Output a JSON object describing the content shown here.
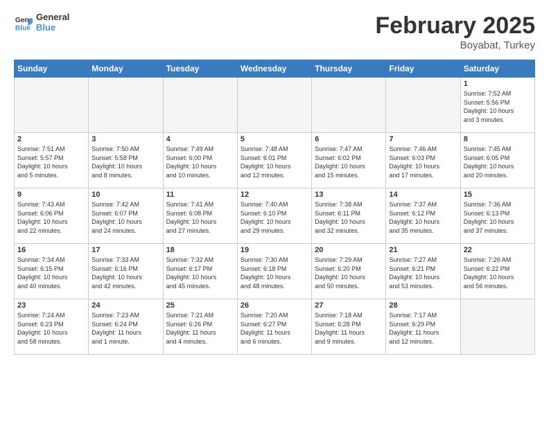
{
  "header": {
    "logo_general": "General",
    "logo_blue": "Blue",
    "month_title": "February 2025",
    "location": "Boyabat, Turkey"
  },
  "weekdays": [
    "Sunday",
    "Monday",
    "Tuesday",
    "Wednesday",
    "Thursday",
    "Friday",
    "Saturday"
  ],
  "weeks": [
    [
      {
        "day": "",
        "info": ""
      },
      {
        "day": "",
        "info": ""
      },
      {
        "day": "",
        "info": ""
      },
      {
        "day": "",
        "info": ""
      },
      {
        "day": "",
        "info": ""
      },
      {
        "day": "",
        "info": ""
      },
      {
        "day": "1",
        "info": "Sunrise: 7:52 AM\nSunset: 5:56 PM\nDaylight: 10 hours\nand 3 minutes."
      }
    ],
    [
      {
        "day": "2",
        "info": "Sunrise: 7:51 AM\nSunset: 5:57 PM\nDaylight: 10 hours\nand 5 minutes."
      },
      {
        "day": "3",
        "info": "Sunrise: 7:50 AM\nSunset: 5:58 PM\nDaylight: 10 hours\nand 8 minutes."
      },
      {
        "day": "4",
        "info": "Sunrise: 7:49 AM\nSunset: 6:00 PM\nDaylight: 10 hours\nand 10 minutes."
      },
      {
        "day": "5",
        "info": "Sunrise: 7:48 AM\nSunset: 6:01 PM\nDaylight: 10 hours\nand 12 minutes."
      },
      {
        "day": "6",
        "info": "Sunrise: 7:47 AM\nSunset: 6:02 PM\nDaylight: 10 hours\nand 15 minutes."
      },
      {
        "day": "7",
        "info": "Sunrise: 7:46 AM\nSunset: 6:03 PM\nDaylight: 10 hours\nand 17 minutes."
      },
      {
        "day": "8",
        "info": "Sunrise: 7:45 AM\nSunset: 6:05 PM\nDaylight: 10 hours\nand 20 minutes."
      }
    ],
    [
      {
        "day": "9",
        "info": "Sunrise: 7:43 AM\nSunset: 6:06 PM\nDaylight: 10 hours\nand 22 minutes."
      },
      {
        "day": "10",
        "info": "Sunrise: 7:42 AM\nSunset: 6:07 PM\nDaylight: 10 hours\nand 24 minutes."
      },
      {
        "day": "11",
        "info": "Sunrise: 7:41 AM\nSunset: 6:08 PM\nDaylight: 10 hours\nand 27 minutes."
      },
      {
        "day": "12",
        "info": "Sunrise: 7:40 AM\nSunset: 6:10 PM\nDaylight: 10 hours\nand 29 minutes."
      },
      {
        "day": "13",
        "info": "Sunrise: 7:38 AM\nSunset: 6:11 PM\nDaylight: 10 hours\nand 32 minutes."
      },
      {
        "day": "14",
        "info": "Sunrise: 7:37 AM\nSunset: 6:12 PM\nDaylight: 10 hours\nand 35 minutes."
      },
      {
        "day": "15",
        "info": "Sunrise: 7:36 AM\nSunset: 6:13 PM\nDaylight: 10 hours\nand 37 minutes."
      }
    ],
    [
      {
        "day": "16",
        "info": "Sunrise: 7:34 AM\nSunset: 6:15 PM\nDaylight: 10 hours\nand 40 minutes."
      },
      {
        "day": "17",
        "info": "Sunrise: 7:33 AM\nSunset: 6:16 PM\nDaylight: 10 hours\nand 42 minutes."
      },
      {
        "day": "18",
        "info": "Sunrise: 7:32 AM\nSunset: 6:17 PM\nDaylight: 10 hours\nand 45 minutes."
      },
      {
        "day": "19",
        "info": "Sunrise: 7:30 AM\nSunset: 6:18 PM\nDaylight: 10 hours\nand 48 minutes."
      },
      {
        "day": "20",
        "info": "Sunrise: 7:29 AM\nSunset: 6:20 PM\nDaylight: 10 hours\nand 50 minutes."
      },
      {
        "day": "21",
        "info": "Sunrise: 7:27 AM\nSunset: 6:21 PM\nDaylight: 10 hours\nand 53 minutes."
      },
      {
        "day": "22",
        "info": "Sunrise: 7:26 AM\nSunset: 6:22 PM\nDaylight: 10 hours\nand 56 minutes."
      }
    ],
    [
      {
        "day": "23",
        "info": "Sunrise: 7:24 AM\nSunset: 6:23 PM\nDaylight: 10 hours\nand 58 minutes."
      },
      {
        "day": "24",
        "info": "Sunrise: 7:23 AM\nSunset: 6:24 PM\nDaylight: 11 hours\nand 1 minute."
      },
      {
        "day": "25",
        "info": "Sunrise: 7:21 AM\nSunset: 6:26 PM\nDaylight: 11 hours\nand 4 minutes."
      },
      {
        "day": "26",
        "info": "Sunrise: 7:20 AM\nSunset: 6:27 PM\nDaylight: 11 hours\nand 6 minutes."
      },
      {
        "day": "27",
        "info": "Sunrise: 7:18 AM\nSunset: 6:28 PM\nDaylight: 11 hours\nand 9 minutes."
      },
      {
        "day": "28",
        "info": "Sunrise: 7:17 AM\nSunset: 6:29 PM\nDaylight: 11 hours\nand 12 minutes."
      },
      {
        "day": "",
        "info": ""
      }
    ]
  ]
}
